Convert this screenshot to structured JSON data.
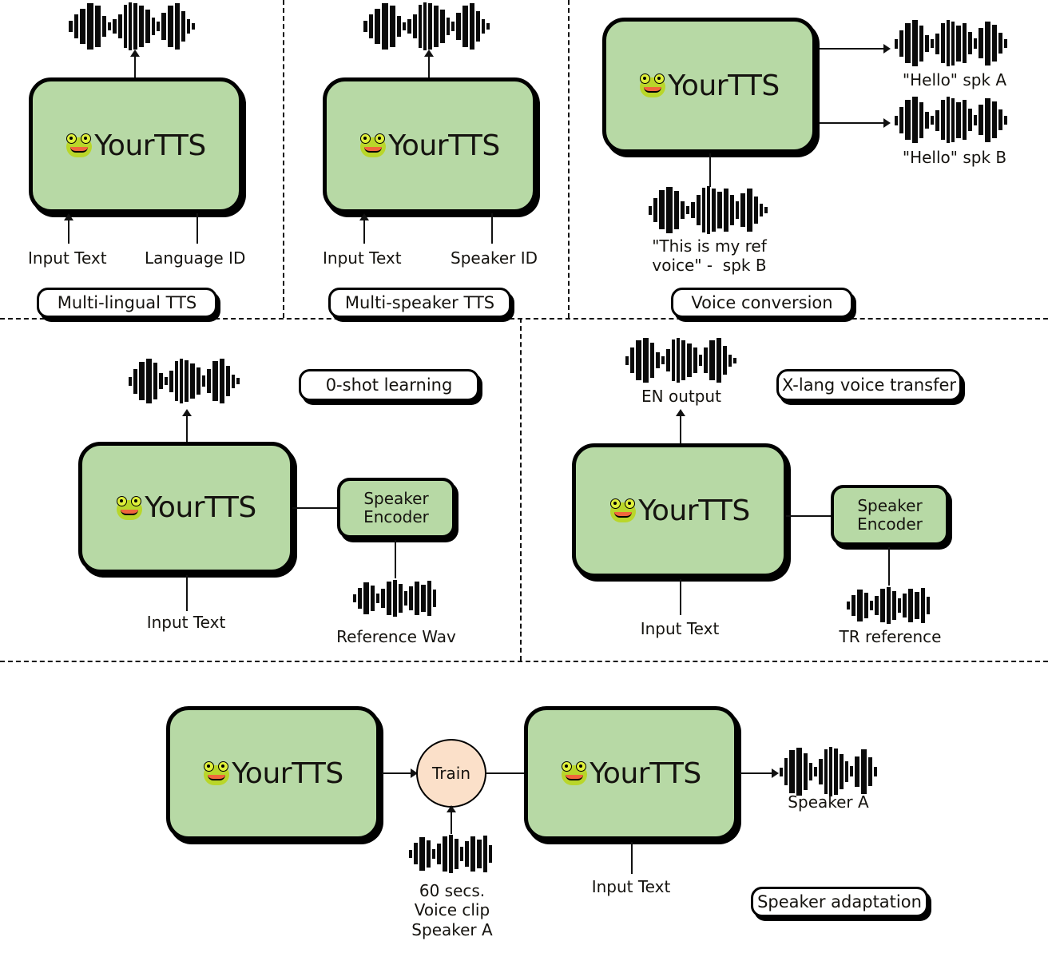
{
  "figure": {
    "title": "YourTTS capability diagram",
    "brand_name": "YourTTS",
    "icon": "frog-face-icon",
    "colors": {
      "model_fill": "#b7d9a5",
      "train_fill": "#fbe0c9",
      "outline": "#000000",
      "background": "#ffffff"
    }
  },
  "panels": [
    {
      "id": "multi-lingual-tts",
      "pill_label": "Multi-lingual TTS",
      "model_label": "YourTTS",
      "inputs": [
        "Input Text",
        "Language ID"
      ],
      "outputs": [
        {
          "type": "waveform",
          "caption": ""
        }
      ]
    },
    {
      "id": "multi-speaker-tts",
      "pill_label": "Multi-speaker TTS",
      "model_label": "YourTTS",
      "inputs": [
        "Input Text",
        "Speaker ID"
      ],
      "outputs": [
        {
          "type": "waveform",
          "caption": ""
        }
      ]
    },
    {
      "id": "voice-conversion",
      "pill_label": "Voice conversion",
      "model_label": "YourTTS",
      "inputs": [],
      "reference_caption": "\"This is my ref\nvoice\" -  spk B",
      "outputs": [
        {
          "type": "waveform",
          "caption": "\"Hello\" spk A"
        },
        {
          "type": "waveform",
          "caption": "\"Hello\" spk B"
        }
      ]
    },
    {
      "id": "zero-shot-learning",
      "pill_label": "0-shot learning",
      "model_label": "YourTTS",
      "encoder_label": "Speaker\nEncoder",
      "inputs": [
        "Input Text"
      ],
      "reference_caption": "Reference Wav",
      "outputs": [
        {
          "type": "waveform",
          "caption": ""
        }
      ]
    },
    {
      "id": "x-lang-voice-transfer",
      "pill_label": "X-lang voice transfer",
      "model_label": "YourTTS",
      "encoder_label": "Speaker\nEncoder",
      "inputs": [
        "Input Text"
      ],
      "reference_caption": "TR reference",
      "outputs": [
        {
          "type": "waveform",
          "caption": "EN output"
        }
      ]
    },
    {
      "id": "speaker-adaptation",
      "pill_label": "Speaker adaptation",
      "model_label_left": "YourTTS",
      "model_label_right": "YourTTS",
      "train_label": "Train",
      "train_clip_caption": "60 secs.\nVoice clip\nSpeaker A",
      "inputs": [
        "Input Text"
      ],
      "outputs": [
        {
          "type": "waveform",
          "caption": "Speaker A"
        }
      ]
    }
  ]
}
